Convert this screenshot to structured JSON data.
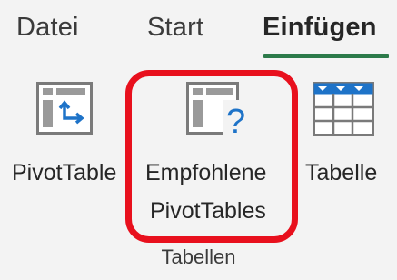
{
  "tabs": [
    {
      "label": "Datei",
      "active": false
    },
    {
      "label": "Start",
      "active": false
    },
    {
      "label": "Einfügen",
      "active": true
    }
  ],
  "colors": {
    "accent": "#2c7a4a",
    "highlight": "#e8101d",
    "icon_blue": "#1e73c8"
  },
  "buttons": {
    "pivot_table": {
      "label": "PivotTable",
      "icon": "pivot-table-icon"
    },
    "recommended": {
      "line1": "Empfohlene",
      "line2": "PivotTables",
      "icon": "recommended-pivot-icon"
    },
    "table": {
      "label": "Tabelle",
      "icon": "table-icon"
    }
  },
  "group": {
    "label": "Tabellen"
  }
}
